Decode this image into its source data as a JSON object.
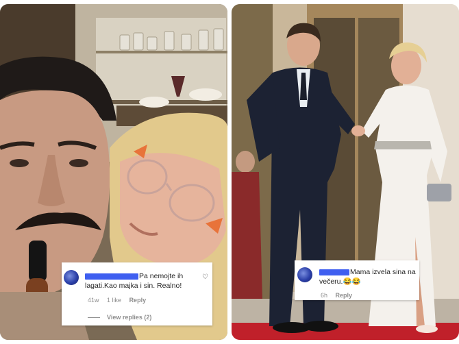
{
  "left_comment": {
    "text_line1": "Pa nemojte ih",
    "text_line2": "lagati.Kao majka i sin. Realno!",
    "time": "41w",
    "likes": "1 like",
    "reply": "Reply",
    "view_replies": "View replies (2)",
    "like_icon": "heart-outline"
  },
  "right_comment": {
    "text_line1": "Mama izvela sina na",
    "text_line2": "večeru.",
    "emoji": "😂😂",
    "time": "6h",
    "reply": "Reply"
  },
  "colors": {
    "redaction": "#3f5ff0",
    "carpet": "#c0202a",
    "suit": "#1c2233",
    "dress": "#f4f1ec"
  }
}
